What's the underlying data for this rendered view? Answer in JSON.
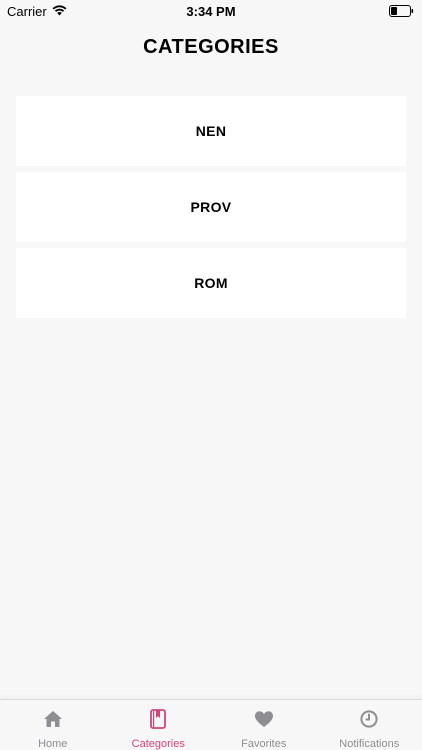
{
  "status_bar": {
    "carrier": "Carrier",
    "time": "3:34 PM"
  },
  "page": {
    "title": "CATEGORIES"
  },
  "categories": [
    {
      "label": "NEN"
    },
    {
      "label": "PROV"
    },
    {
      "label": "ROM"
    }
  ],
  "tab_bar": {
    "active_color": "#d4447a",
    "inactive_color": "#8e8e93",
    "tabs": [
      {
        "label": "Home",
        "icon": "home-icon",
        "active": false
      },
      {
        "label": "Categories",
        "icon": "book-icon",
        "active": true
      },
      {
        "label": "Favorites",
        "icon": "heart-icon",
        "active": false
      },
      {
        "label": "Notifications",
        "icon": "clock-icon",
        "active": false
      }
    ]
  }
}
